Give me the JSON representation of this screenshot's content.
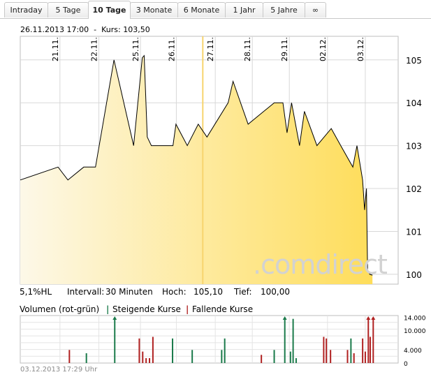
{
  "tabs": [
    {
      "label": "Intraday",
      "active": false
    },
    {
      "label": "5 Tage",
      "active": false
    },
    {
      "label": "10 Tage",
      "active": true
    },
    {
      "label": "3 Monate",
      "active": false
    },
    {
      "label": "6 Monate",
      "active": false
    },
    {
      "label": "1 Jahr",
      "active": false
    },
    {
      "label": "5 Jahre",
      "active": false
    },
    {
      "label": "∞",
      "active": false
    }
  ],
  "info_line": "26.11.2013 17:00  -  Kurs: 103,50",
  "watermark": ".comdirect",
  "stats": {
    "range_pct": "5,1%HL",
    "interval_label": "Intervall:",
    "interval_value": "30 Minuten",
    "high_label": "Hoch:",
    "high_value": "105,10",
    "low_label": "Tief:",
    "low_value": "100,00"
  },
  "volume_legend": {
    "title": "Volumen (rot-grün)",
    "rising": "Steigende Kurse",
    "falling": "Fallende Kurse"
  },
  "footer": "03.12.2013 17:29 Uhr",
  "colors": {
    "area_light": "#fdf8e8",
    "area_dark": "#fedd5a",
    "line": "#000000",
    "marker": "#f7d46e",
    "rising": "#1a7a4a",
    "falling": "#b02020",
    "grid": "#d8d8d8"
  },
  "chart_data": [
    {
      "type": "area",
      "y_ticks": [
        100,
        101,
        102,
        103,
        104,
        105
      ],
      "ylim": [
        99.77,
        105.55
      ],
      "x_ticks": [
        "21.11.",
        "22.11.",
        "25.11.",
        "26.11.",
        "27.11.",
        "28.11.",
        "29.11.",
        "02.12.",
        "03.12."
      ],
      "highlight": "26.11.2013 17:00",
      "x_range": [
        0,
        100
      ],
      "tick_positions": [
        10.5,
        20.8,
        31.8,
        41.3,
        51.6,
        61.4,
        71.2,
        81.3,
        91.3
      ],
      "highlight_position": 48.3,
      "series": [
        {
          "points": [
            [
              0,
              102.2
            ],
            [
              10.0,
              102.5
            ],
            [
              12.6,
              102.2
            ],
            [
              16.8,
              102.5
            ],
            [
              19.9,
              102.5
            ],
            [
              24.8,
              105.0
            ],
            [
              30.0,
              103.0
            ],
            [
              32.3,
              105.05
            ],
            [
              32.8,
              105.1
            ],
            [
              33.6,
              103.2
            ],
            [
              34.7,
              103.0
            ],
            [
              40.4,
              103.0
            ],
            [
              41.2,
              103.5
            ],
            [
              44.2,
              103.0
            ],
            [
              47.1,
              103.5
            ],
            [
              49.4,
              103.2
            ],
            [
              55.0,
              104.0
            ],
            [
              56.3,
              104.5
            ],
            [
              60.3,
              103.5
            ],
            [
              67.2,
              104.0
            ],
            [
              69.5,
              104.0
            ],
            [
              70.6,
              103.3
            ],
            [
              71.8,
              104.0
            ],
            [
              73.9,
              103.0
            ],
            [
              75.2,
              103.8
            ],
            [
              78.5,
              103.0
            ],
            [
              82.3,
              103.4
            ],
            [
              84.8,
              103.0
            ],
            [
              88.0,
              102.5
            ],
            [
              89.1,
              103.0
            ],
            [
              90.6,
              102.2
            ],
            [
              91.1,
              101.5
            ],
            [
              91.6,
              102.0
            ],
            [
              91.9,
              100.1
            ],
            [
              92.5,
              100.0
            ],
            [
              93.2,
              99.98
            ]
          ]
        }
      ]
    },
    {
      "type": "bar",
      "title": "Volumen (rot-grün)",
      "y_ticks": [
        0,
        4000,
        10000,
        14000
      ],
      "y_tick_labels": [
        "0",
        "4.000",
        "10.000",
        "14.000"
      ],
      "ylim": [
        0,
        14500
      ],
      "x_range": [
        0,
        100
      ],
      "bars": [
        {
          "x": 13.0,
          "v": 4000,
          "dir": "down"
        },
        {
          "x": 17.5,
          "v": 3000,
          "dir": "up"
        },
        {
          "x": 25.0,
          "v": 14500,
          "dir": "up"
        },
        {
          "x": 31.5,
          "v": 7500,
          "dir": "down"
        },
        {
          "x": 32.4,
          "v": 3500,
          "dir": "down"
        },
        {
          "x": 33.3,
          "v": 1500,
          "dir": "down"
        },
        {
          "x": 34.2,
          "v": 1500,
          "dir": "down"
        },
        {
          "x": 35.1,
          "v": 8000,
          "dir": "down"
        },
        {
          "x": 40.3,
          "v": 7500,
          "dir": "up"
        },
        {
          "x": 45.5,
          "v": 4000,
          "dir": "up"
        },
        {
          "x": 53.3,
          "v": 4000,
          "dir": "up"
        },
        {
          "x": 54.1,
          "v": 7500,
          "dir": "up"
        },
        {
          "x": 63.8,
          "v": 2500,
          "dir": "down"
        },
        {
          "x": 67.2,
          "v": 4000,
          "dir": "up"
        },
        {
          "x": 70.0,
          "v": 14500,
          "dir": "up"
        },
        {
          "x": 71.5,
          "v": 3500,
          "dir": "up"
        },
        {
          "x": 72.2,
          "v": 13500,
          "dir": "up"
        },
        {
          "x": 73.0,
          "v": 1500,
          "dir": "up"
        },
        {
          "x": 80.3,
          "v": 8000,
          "dir": "down"
        },
        {
          "x": 81.0,
          "v": 7500,
          "dir": "down"
        },
        {
          "x": 82.1,
          "v": 4000,
          "dir": "down"
        },
        {
          "x": 86.6,
          "v": 4000,
          "dir": "down"
        },
        {
          "x": 87.5,
          "v": 7500,
          "dir": "up"
        },
        {
          "x": 88.3,
          "v": 3000,
          "dir": "down"
        },
        {
          "x": 90.6,
          "v": 7500,
          "dir": "down"
        },
        {
          "x": 91.3,
          "v": 3500,
          "dir": "down"
        },
        {
          "x": 92.1,
          "v": 14500,
          "dir": "down"
        },
        {
          "x": 92.6,
          "v": 8000,
          "dir": "down"
        },
        {
          "x": 93.4,
          "v": 14500,
          "dir": "down"
        }
      ]
    }
  ]
}
